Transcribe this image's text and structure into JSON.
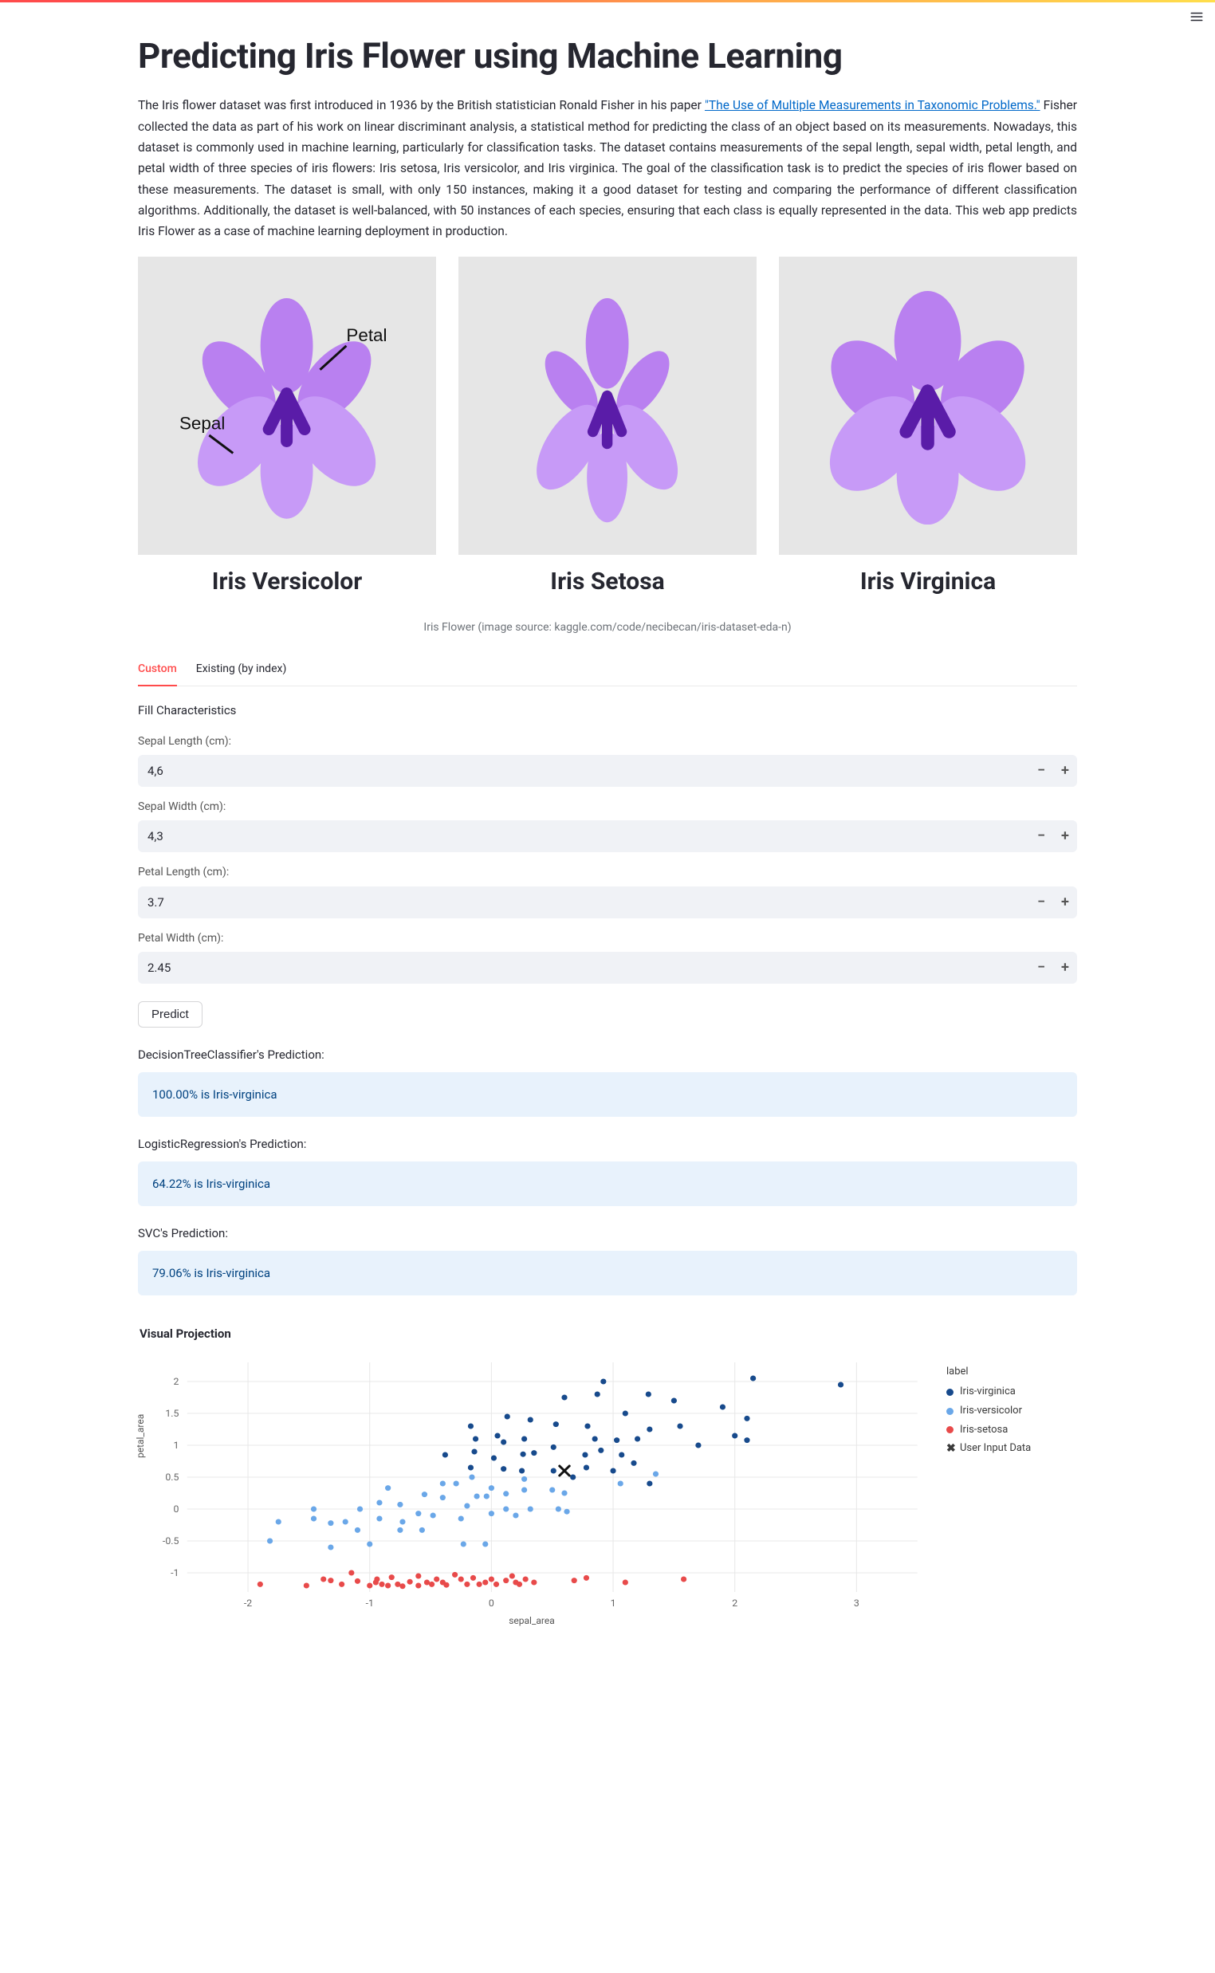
{
  "page": {
    "title": "Predicting Iris Flower using Machine Learning",
    "intro_before_link": "The Iris flower dataset was first introduced in 1936 by the British statistician Ronald Fisher in his paper ",
    "intro_link_text": "\"The Use of Multiple Measurements in Taxonomic Problems.\"",
    "intro_after_link": " Fisher collected the data as part of his work on linear discriminant analysis, a statistical method for predicting the class of an object based on its measurements. Nowadays, this dataset is commonly used in machine learning, particularly for classification tasks. The dataset contains measurements of the sepal length, sepal width, petal length, and petal width of three species of iris flowers: Iris setosa, Iris versicolor, and Iris virginica. The goal of the classification task is to predict the species of iris flower based on these measurements. The dataset is small, with only 150 instances, making it a good dataset for testing and comparing the performance of different classification algorithms. Additionally, the dataset is well-balanced, with 50 instances of each species, ensuring that each class is equally represented in the data. This web app predicts Iris Flower as a case of machine learning deployment in production."
  },
  "gallery": {
    "species": [
      {
        "name": "Iris Versicolor",
        "label_sepal": "Sepal",
        "label_petal": "Petal"
      },
      {
        "name": "Iris Setosa"
      },
      {
        "name": "Iris Virginica"
      }
    ],
    "caption": "Iris Flower (image source: kaggle.com/code/necibecan/iris-dataset-eda-n)"
  },
  "tabs": {
    "items": [
      "Custom",
      "Existing (by index)"
    ],
    "active_index": 0
  },
  "form": {
    "section_label": "Fill Characteristics",
    "fields": [
      {
        "label": "Sepal Length (cm):",
        "value": "4,6"
      },
      {
        "label": "Sepal Width (cm):",
        "value": "4,3"
      },
      {
        "label": "Petal Length (cm):",
        "value": "3.7"
      },
      {
        "label": "Petal Width (cm):",
        "value": "2.45"
      }
    ],
    "predict_button": "Predict"
  },
  "predictions": [
    {
      "label": "DecisionTreeClassifier's Prediction:",
      "result": "100.00% is Iris-virginica"
    },
    {
      "label": "LogisticRegression's Prediction:",
      "result": "64.22% is Iris-virginica"
    },
    {
      "label": "SVC's Prediction:",
      "result": "79.06% is Iris-virginica"
    }
  ],
  "chart": {
    "title": "Visual Projection",
    "xlabel": "sepal_area",
    "ylabel": "petal_area",
    "legend_title": "label",
    "legend": [
      {
        "name": "Iris-virginica",
        "color": "#174a8c"
      },
      {
        "name": "Iris-versicolor",
        "color": "#6aa7e8"
      },
      {
        "name": "Iris-setosa",
        "color": "#e84a4a"
      },
      {
        "name": "User Input Data",
        "marker": "cross",
        "color": "#111"
      }
    ]
  },
  "chart_data": {
    "type": "scatter",
    "xlabel": "sepal_area",
    "ylabel": "petal_area",
    "xlim": [
      -2.5,
      3.5
    ],
    "ylim": [
      -1.3,
      2.3
    ],
    "x_ticks": [
      -2,
      -1,
      0,
      1,
      2,
      3
    ],
    "y_ticks": [
      -1,
      -0.5,
      0,
      0.5,
      1,
      1.5,
      2
    ],
    "series": [
      {
        "name": "Iris-virginica",
        "color": "#174a8c",
        "points": [
          [
            -0.38,
            0.85
          ],
          [
            -0.17,
            0.65
          ],
          [
            -0.17,
            1.3
          ],
          [
            -0.13,
            1.1
          ],
          [
            -0.14,
            0.9
          ],
          [
            0.02,
            0.8
          ],
          [
            0.05,
            1.15
          ],
          [
            0.1,
            0.63
          ],
          [
            0.1,
            1.05
          ],
          [
            0.13,
            1.45
          ],
          [
            0.25,
            0.6
          ],
          [
            0.26,
            0.86
          ],
          [
            0.27,
            1.1
          ],
          [
            0.32,
            1.4
          ],
          [
            0.35,
            0.88
          ],
          [
            0.51,
            0.6
          ],
          [
            0.51,
            0.97
          ],
          [
            0.53,
            1.33
          ],
          [
            0.6,
            1.75
          ],
          [
            0.67,
            0.5
          ],
          [
            0.77,
            0.85
          ],
          [
            0.78,
            0.65
          ],
          [
            0.79,
            1.3
          ],
          [
            0.85,
            1.1
          ],
          [
            0.87,
            1.8
          ],
          [
            0.9,
            0.92
          ],
          [
            0.92,
            2.0
          ],
          [
            1.0,
            0.6
          ],
          [
            1.03,
            1.08
          ],
          [
            1.07,
            0.85
          ],
          [
            1.1,
            1.5
          ],
          [
            1.17,
            0.72
          ],
          [
            1.2,
            1.1
          ],
          [
            1.29,
            1.8
          ],
          [
            1.3,
            1.25
          ],
          [
            1.3,
            0.4
          ],
          [
            1.5,
            1.7
          ],
          [
            1.55,
            1.3
          ],
          [
            1.7,
            1.0
          ],
          [
            1.9,
            1.6
          ],
          [
            2.0,
            1.15
          ],
          [
            2.15,
            2.05
          ],
          [
            2.1,
            1.42
          ],
          [
            2.1,
            1.08
          ],
          [
            2.87,
            1.95
          ]
        ]
      },
      {
        "name": "Iris-versicolor",
        "color": "#6aa7e8",
        "points": [
          [
            -1.82,
            -0.5
          ],
          [
            -1.75,
            -0.2
          ],
          [
            -1.46,
            -0.15
          ],
          [
            -1.46,
            0.0
          ],
          [
            -1.32,
            -0.22
          ],
          [
            -1.32,
            -0.6
          ],
          [
            -1.2,
            -0.2
          ],
          [
            -1.1,
            -0.33
          ],
          [
            -1.08,
            0.0
          ],
          [
            -1.0,
            -0.55
          ],
          [
            -0.92,
            -0.15
          ],
          [
            -0.92,
            0.1
          ],
          [
            -0.85,
            0.33
          ],
          [
            -0.75,
            -0.33
          ],
          [
            -0.75,
            0.07
          ],
          [
            -0.73,
            -0.2
          ],
          [
            -0.6,
            -0.07
          ],
          [
            -0.57,
            -0.33
          ],
          [
            -0.55,
            0.23
          ],
          [
            -0.48,
            -0.1
          ],
          [
            -0.4,
            0.18
          ],
          [
            -0.4,
            0.4
          ],
          [
            -0.29,
            0.4
          ],
          [
            -0.25,
            -0.15
          ],
          [
            -0.23,
            -0.55
          ],
          [
            -0.2,
            0.05
          ],
          [
            -0.16,
            0.5
          ],
          [
            -0.12,
            0.2
          ],
          [
            -0.05,
            -0.55
          ],
          [
            -0.04,
            0.2
          ],
          [
            0.0,
            -0.07
          ],
          [
            0.0,
            0.33
          ],
          [
            0.12,
            0.0
          ],
          [
            0.12,
            0.24
          ],
          [
            0.2,
            -0.1
          ],
          [
            0.27,
            0.3
          ],
          [
            0.27,
            0.47
          ],
          [
            0.32,
            0.0
          ],
          [
            0.5,
            0.3
          ],
          [
            0.55,
            0.0
          ],
          [
            0.6,
            0.25
          ],
          [
            0.62,
            -0.04
          ],
          [
            1.06,
            0.4
          ],
          [
            1.35,
            0.55
          ]
        ]
      },
      {
        "name": "Iris-setosa",
        "color": "#e84a4a",
        "points": [
          [
            -1.9,
            -1.18
          ],
          [
            -1.52,
            -1.2
          ],
          [
            -1.38,
            -1.1
          ],
          [
            -1.32,
            -1.12
          ],
          [
            -1.23,
            -1.18
          ],
          [
            -1.15,
            -1.0
          ],
          [
            -1.1,
            -1.13
          ],
          [
            -1.0,
            -1.2
          ],
          [
            -0.95,
            -1.15
          ],
          [
            -0.94,
            -1.1
          ],
          [
            -0.9,
            -1.18
          ],
          [
            -0.85,
            -1.2
          ],
          [
            -0.82,
            -1.07
          ],
          [
            -0.77,
            -1.18
          ],
          [
            -0.73,
            -1.21
          ],
          [
            -0.67,
            -1.14
          ],
          [
            -0.6,
            -1.2
          ],
          [
            -0.6,
            -1.05
          ],
          [
            -0.53,
            -1.15
          ],
          [
            -0.49,
            -1.18
          ],
          [
            -0.45,
            -1.1
          ],
          [
            -0.4,
            -1.15
          ],
          [
            -0.37,
            -1.19
          ],
          [
            -0.3,
            -1.03
          ],
          [
            -0.25,
            -1.1
          ],
          [
            -0.2,
            -1.18
          ],
          [
            -0.15,
            -1.08
          ],
          [
            -0.1,
            -1.18
          ],
          [
            -0.05,
            -1.15
          ],
          [
            0.0,
            -1.1
          ],
          [
            0.04,
            -1.18
          ],
          [
            0.12,
            -1.12
          ],
          [
            0.17,
            -1.05
          ],
          [
            0.2,
            -1.15
          ],
          [
            0.23,
            -1.18
          ],
          [
            0.28,
            -1.1
          ],
          [
            0.35,
            -1.15
          ],
          [
            0.68,
            -1.12
          ],
          [
            0.78,
            -1.08
          ],
          [
            1.1,
            -1.15
          ],
          [
            1.58,
            -1.1
          ]
        ]
      },
      {
        "name": "User Input Data",
        "color": "#111111",
        "marker": "cross",
        "points": [
          [
            0.6,
            0.6
          ]
        ]
      }
    ]
  }
}
